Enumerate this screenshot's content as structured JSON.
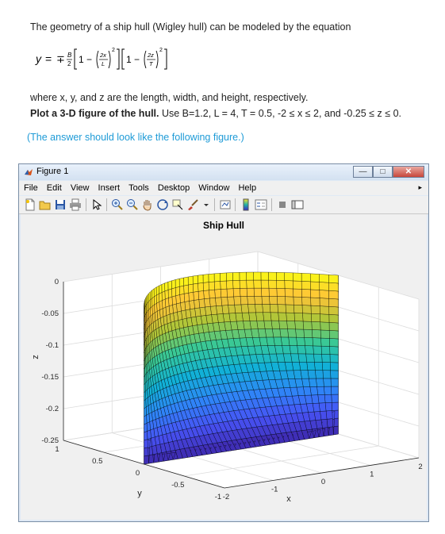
{
  "doc": {
    "intro": "The geometry of a ship hull (Wigley hull) can be modeled by the equation",
    "eq_y": "y",
    "eq_eq": "=",
    "eq_pm": "∓",
    "eq_B": "B",
    "eq_2": "2",
    "eq_one1": "1",
    "eq_minus": "−",
    "eq_2x": "2x",
    "eq_L": "L",
    "eq_one2": "1",
    "eq_2z": "2z",
    "eq_T": "T",
    "eq_sq": "2",
    "where": "where x, y, and z are the length, width, and height, respectively.",
    "task_bold": "Plot a 3-D figure of the hull.",
    "task_rest": " Use B=1.2, L = 4, T = 0.5, -2 ≤ x ≤ 2, and -0.25 ≤ z ≤ 0.",
    "answer_note": "(The answer should look like the following figure.)"
  },
  "window": {
    "title": "Figure 1",
    "menu": [
      "File",
      "Edit",
      "View",
      "Insert",
      "Tools",
      "Desktop",
      "Window",
      "Help"
    ],
    "minimize": "—",
    "maximize": "□",
    "close": "✕"
  },
  "chart_data": {
    "type": "surface",
    "title": "Ship Hull",
    "xlabel": "x",
    "ylabel": "y",
    "zlabel": "z",
    "xlim": [
      -2,
      2
    ],
    "ylim": [
      -1,
      1
    ],
    "zlim": [
      -0.25,
      0
    ],
    "x_ticks": [
      "-2",
      "-1",
      "0",
      "1",
      "2"
    ],
    "y_ticks": [
      "-1",
      "-0.5",
      "0",
      "0.5",
      "1"
    ],
    "z_ticks": [
      "0",
      "-0.05",
      "-0.1",
      "-0.15",
      "-0.2",
      "-0.25"
    ],
    "params": {
      "B": 1.2,
      "L": 4,
      "T": 0.5
    },
    "colormap": "parula",
    "grid": true
  }
}
